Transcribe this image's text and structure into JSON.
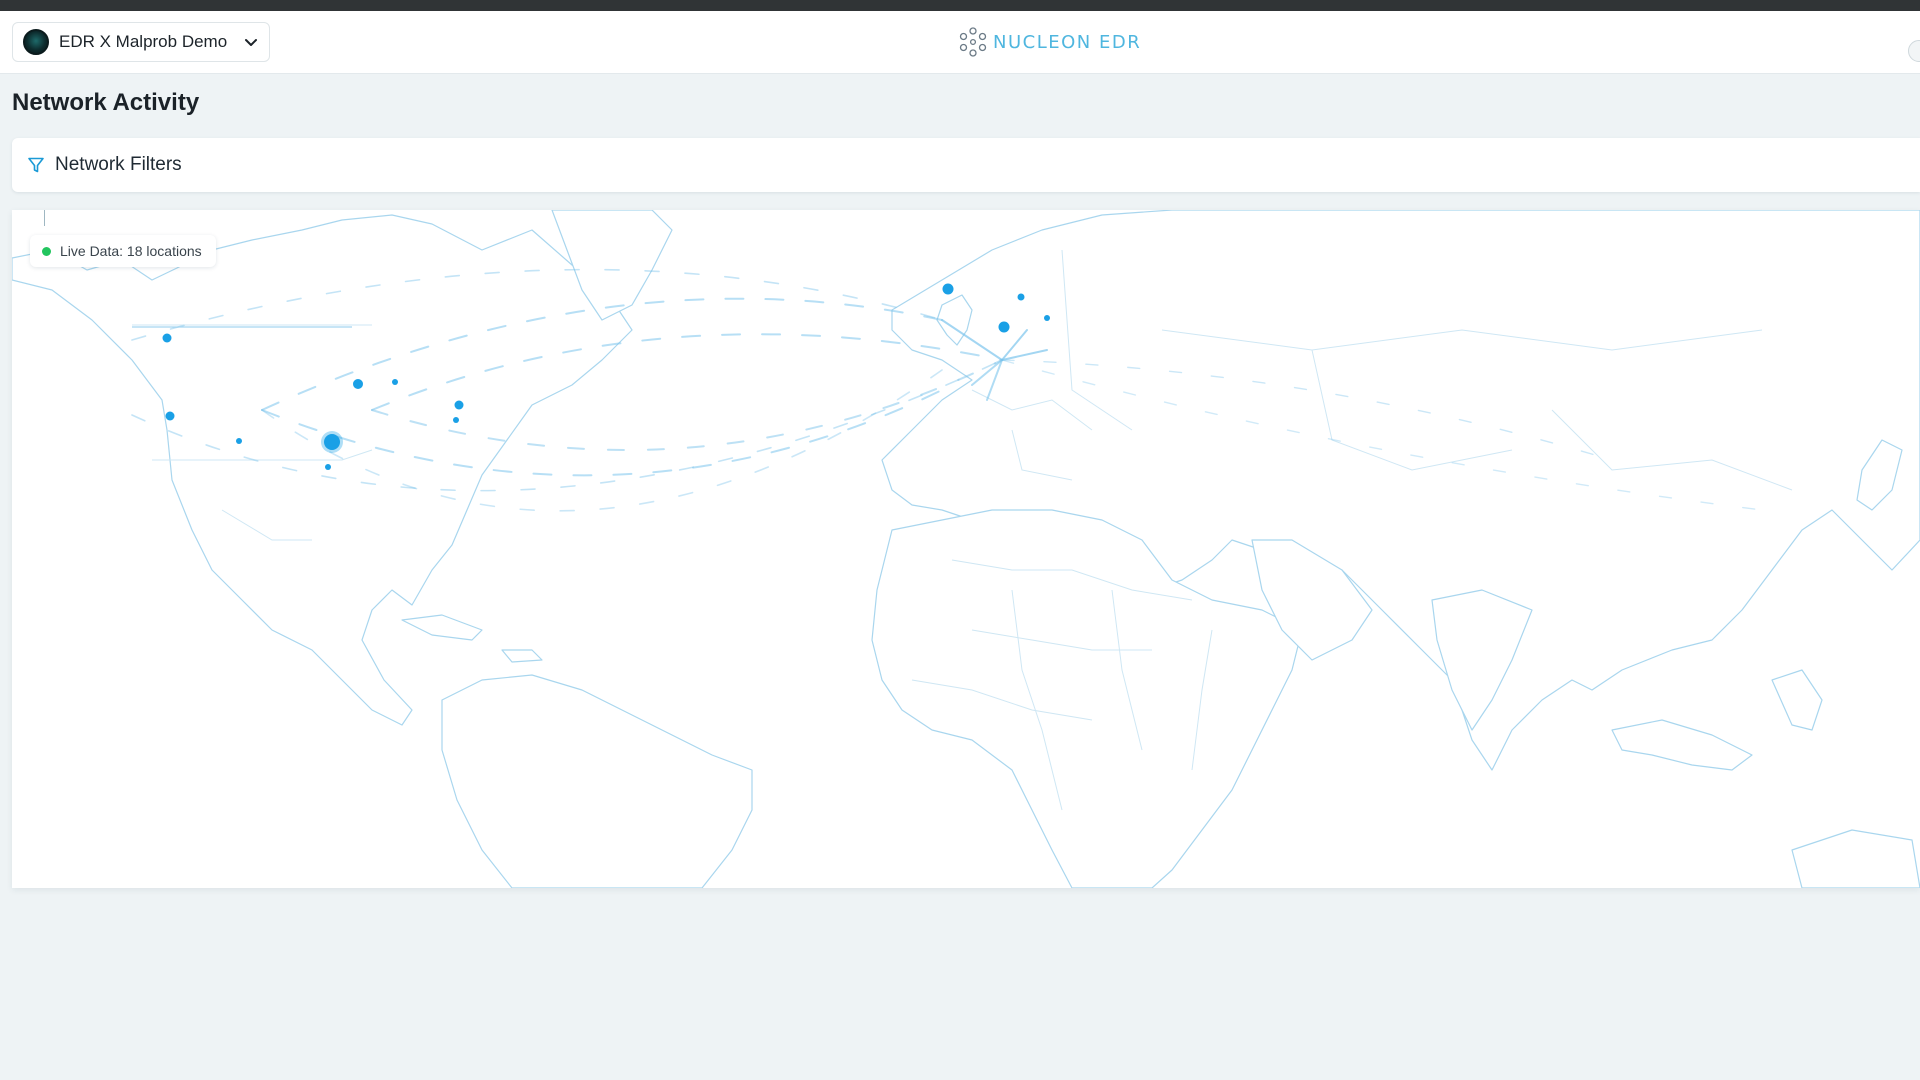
{
  "header": {
    "org_select": {
      "label": "EDR X Malprob Demo"
    },
    "logo_text": "NUCLEON EDR"
  },
  "page": {
    "title": "Network Activity"
  },
  "filters": {
    "label": "Network Filters"
  },
  "map": {
    "live_label": "Live Data: 18 locations",
    "colors": {
      "accent": "#1aa0e6",
      "land_border": "#a9d6ee",
      "live": "#22c55e"
    }
  }
}
